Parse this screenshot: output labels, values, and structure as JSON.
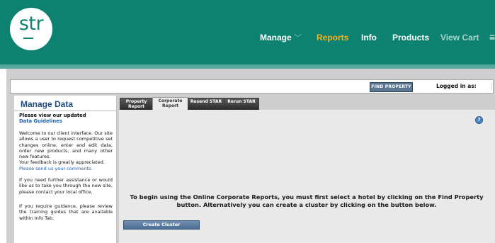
{
  "brand": {
    "logo_text": "str"
  },
  "nav": {
    "manage": "Manage",
    "reports": "Reports",
    "info": "Info",
    "products": "Products",
    "view_cart": "View Cart"
  },
  "header": {
    "find_property": "FIND PROPERTY",
    "logged_in_label": "Logged in as:"
  },
  "sidebar": {
    "title": "Manage Data",
    "guidelines_heading": "Please view our updated",
    "guidelines_link": "Data Guidelines",
    "welcome": "Welcome to our client interface. Our site allows a user to request competitive set changes online, enter and edit data, order new products, and many other new features.",
    "feedback": "Your feedback is greatly appreciated.",
    "feedback_link": "Please send us your comments.",
    "assistance": "If you need further assistance or would like us to take you through the new site, please contact your local office.",
    "training": "If you require guidance, please review the training guides that are available within Info Tab."
  },
  "tabs": [
    {
      "line1": "Property",
      "line2": "Report",
      "active": false
    },
    {
      "line1": "Corporate",
      "line2": "Report",
      "active": true
    },
    {
      "line1": "Resend STAR",
      "line2": "",
      "active": false
    },
    {
      "line1": "Rerun STAR",
      "line2": "",
      "active": false
    }
  ],
  "content": {
    "help_symbol": "?",
    "message": "To begin using the Online Corporate Reports, you must first select a hotel by clicking on the Find Property button. Alternatively you can create a cluster by clicking on the button below.",
    "create_cluster": "Create Cluster"
  },
  "colors": {
    "nav_bg": "#0d8270",
    "active_nav": "#f5b41b",
    "link_blue": "#1f5fa8",
    "button_blue": "#5c7793"
  },
  "icons": {
    "menu": "hamburger-menu-icon",
    "dropdown": "chevron-down-icon",
    "help": "help-icon"
  }
}
